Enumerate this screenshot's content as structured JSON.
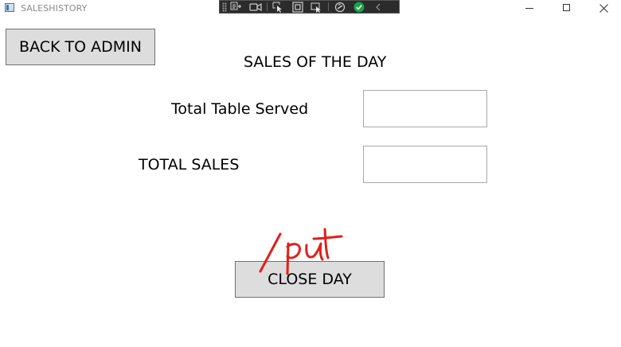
{
  "window": {
    "title": "SALESHISTORY"
  },
  "debug_toolbar": {
    "icons": [
      "grip-icon",
      "visual-tree-icon",
      "record-icon",
      "select-element-icon",
      "adorner-icon",
      "track-focus-icon",
      "binding-failures-icon",
      "hot-reload-ok-icon",
      "collapse-icon"
    ],
    "status_color": "#16a34a"
  },
  "header": {
    "back_label": "BACK TO ADMIN",
    "title": "SALES OF THE DAY"
  },
  "form": {
    "tables_label": "Total Table Served",
    "tables_value": "",
    "sales_label": "TOTAL SALES",
    "sales_value": ""
  },
  "actions": {
    "close_day_label": "CLOSE DAY"
  },
  "annotation": {
    "text": "put",
    "color": "#e0201c"
  }
}
